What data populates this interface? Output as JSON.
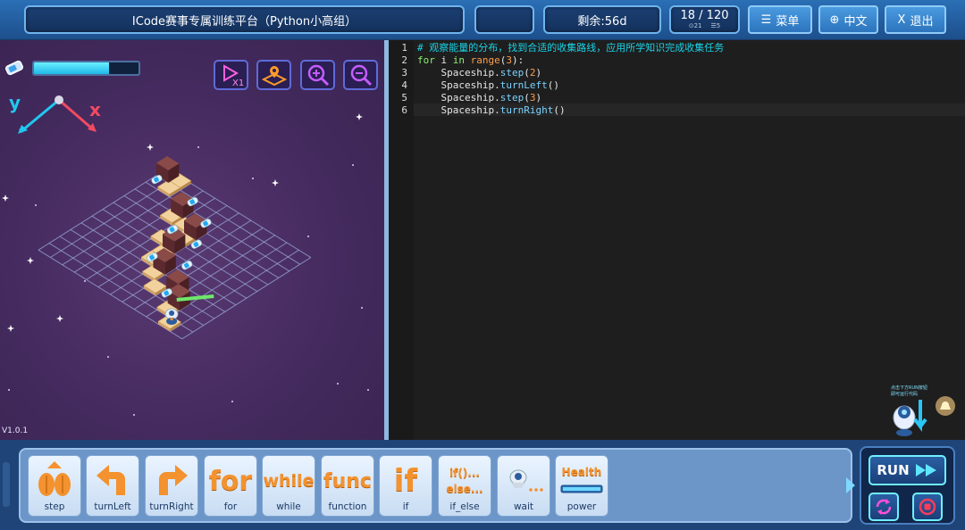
{
  "header": {
    "title": "ICode赛事专属训练平台（Python小高组）",
    "blank": "",
    "remaining": "剩余:56d",
    "level": "18 / 120",
    "level_sub_a": "⊙21",
    "level_sub_b": "☰5",
    "menu_label": "菜单",
    "lang_label": "中文",
    "exit_label": "退出",
    "menu_icon": "menu-icon",
    "lang_icon": "globe-icon",
    "exit_icon": "close-icon"
  },
  "game": {
    "energy_fraction": 0.72,
    "axis_y": "y",
    "axis_x": "x",
    "version": "V1.0.1",
    "colors": {
      "accent": "#21c9f0",
      "board": "#9aa8d8",
      "block": "#7a3a3a",
      "tile": "#f2d29c"
    }
  },
  "editor": {
    "lines": [
      {
        "n": "1",
        "parts": [
          {
            "t": "# 观察能量的分布，找到合适的收集路线，应用所学知识完成收集任务",
            "c": "c-cmt"
          }
        ]
      },
      {
        "n": "2",
        "parts": [
          {
            "t": "for",
            "c": "c-kw"
          },
          {
            "t": " i ",
            "c": ""
          },
          {
            "t": "in",
            "c": "c-kw"
          },
          {
            "t": " ",
            "c": ""
          },
          {
            "t": "range",
            "c": "c-kw2"
          },
          {
            "t": "(",
            "c": ""
          },
          {
            "t": "3",
            "c": "c-num"
          },
          {
            "t": "):",
            "c": ""
          }
        ]
      },
      {
        "n": "3",
        "parts": [
          {
            "t": "    Spaceship.",
            "c": ""
          },
          {
            "t": "step",
            "c": "c-fn"
          },
          {
            "t": "(",
            "c": ""
          },
          {
            "t": "2",
            "c": "c-num"
          },
          {
            "t": ")",
            "c": ""
          }
        ]
      },
      {
        "n": "4",
        "parts": [
          {
            "t": "    Spaceship.",
            "c": ""
          },
          {
            "t": "turnLeft",
            "c": "c-fn"
          },
          {
            "t": "()",
            "c": ""
          }
        ]
      },
      {
        "n": "5",
        "parts": [
          {
            "t": "    Spaceship.",
            "c": ""
          },
          {
            "t": "step",
            "c": "c-fn"
          },
          {
            "t": "(",
            "c": ""
          },
          {
            "t": "3",
            "c": "c-num"
          },
          {
            "t": ")",
            "c": ""
          }
        ]
      },
      {
        "n": "6",
        "parts": [
          {
            "t": "    Spaceship.",
            "c": ""
          },
          {
            "t": "turnRight",
            "c": "c-fn"
          },
          {
            "t": "()",
            "c": ""
          }
        ]
      }
    ],
    "hint": "点击下方RUN按钮\n即可运行代码"
  },
  "blocks": [
    {
      "label": "step",
      "glyph": "",
      "icon": "step-icon"
    },
    {
      "label": "turnLeft",
      "glyph": "",
      "icon": "turn-left-icon"
    },
    {
      "label": "turnRight",
      "glyph": "",
      "icon": "turn-right-icon"
    },
    {
      "label": "for",
      "glyph": "for",
      "icon": ""
    },
    {
      "label": "while",
      "glyph": "while",
      "icon": ""
    },
    {
      "label": "function",
      "glyph": "func",
      "icon": ""
    },
    {
      "label": "if",
      "glyph": "if",
      "icon": ""
    },
    {
      "label": "if_else",
      "glyph": "if()...\nelse...",
      "icon": ""
    },
    {
      "label": "wait",
      "glyph": "",
      "icon": "robot-icon"
    },
    {
      "label": "power",
      "glyph": "Health",
      "icon": "power-bar-icon"
    }
  ],
  "run": {
    "label": "RUN",
    "reset_icon": "reset-icon",
    "stop_icon": "stop-icon"
  }
}
